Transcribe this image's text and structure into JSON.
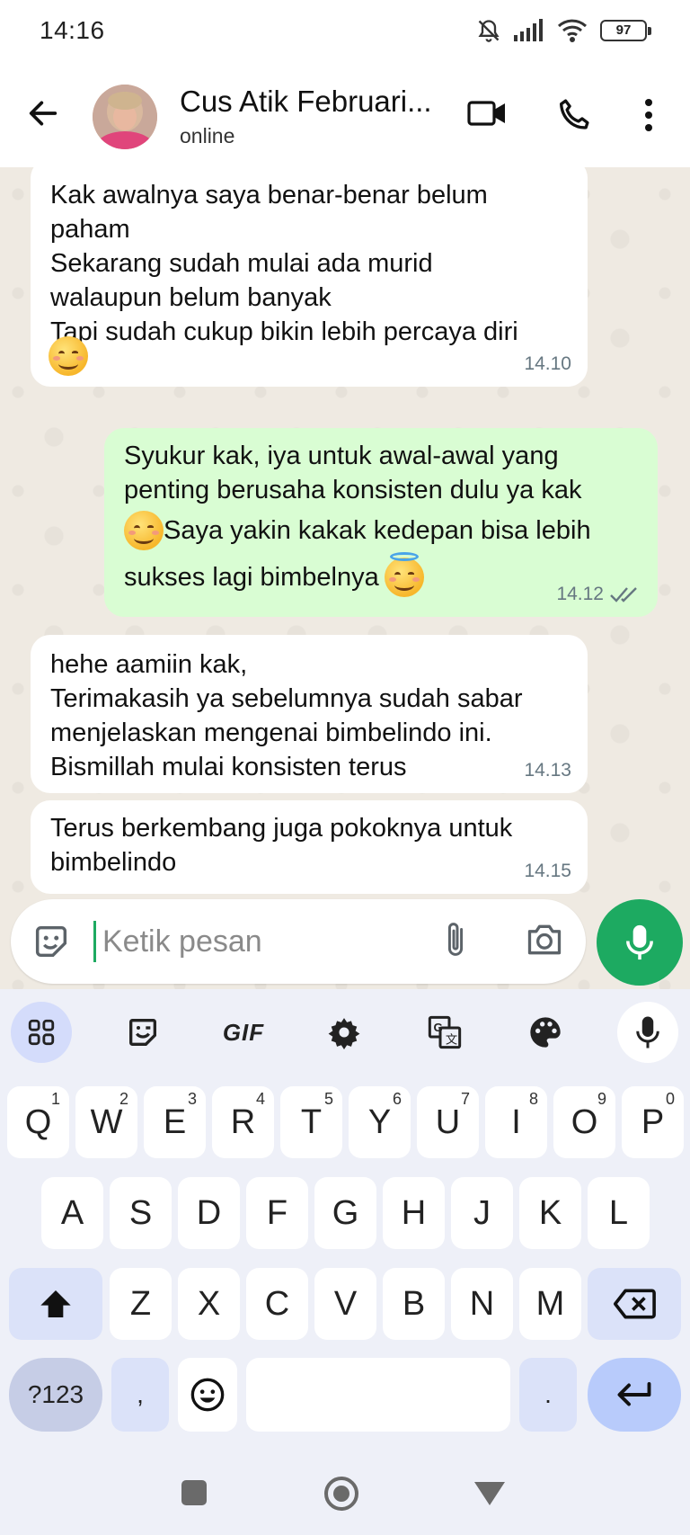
{
  "status_bar": {
    "time": "14:16",
    "battery": "97"
  },
  "header": {
    "contact_name": "Cus Atik Februari...",
    "contact_status": "online"
  },
  "messages": [
    {
      "dir": "in",
      "text": "Kak awalnya saya benar-benar belum\npaham\nSekarang sudah mulai ada murid\nwalaupun belum banyak\nTapi sudah cukup bikin lebih percaya diri",
      "time": "14.10",
      "emoji": "smiling-face-icon"
    },
    {
      "dir": "out",
      "text1": "Syukur kak, iya untuk awal-awal yang\npenting berusaha konsisten dulu ya kak",
      "text2": " Saya yakin kakak kedepan bisa lebih",
      "text3": "sukses lagi bimbelnya",
      "time": "14.12",
      "status": "read"
    },
    {
      "dir": "in",
      "text": "hehe aamiin kak,\nTerimakasih ya sebelumnya sudah sabar\nmenjelaskan mengenai bimbelindo ini.\nBismillah mulai konsisten terus",
      "time": "14.13"
    },
    {
      "dir": "in",
      "text": "Terus berkembang juga pokoknya untuk\nbimbelindo",
      "time": "14.15"
    }
  ],
  "composer": {
    "placeholder": "Ketik pesan"
  },
  "keyboard": {
    "toolbar": [
      "apps-icon",
      "sticker-icon",
      "GIF",
      "gear-icon",
      "translate-icon",
      "palette-icon",
      "microphone-icon"
    ],
    "gif_label": "GIF",
    "row1": [
      {
        "k": "Q",
        "n": "1"
      },
      {
        "k": "W",
        "n": "2"
      },
      {
        "k": "E",
        "n": "3"
      },
      {
        "k": "R",
        "n": "4"
      },
      {
        "k": "T",
        "n": "5"
      },
      {
        "k": "Y",
        "n": "6"
      },
      {
        "k": "U",
        "n": "7"
      },
      {
        "k": "I",
        "n": "8"
      },
      {
        "k": "O",
        "n": "9"
      },
      {
        "k": "P",
        "n": "0"
      }
    ],
    "row2": [
      "A",
      "S",
      "D",
      "F",
      "G",
      "H",
      "J",
      "K",
      "L"
    ],
    "row3": [
      "Z",
      "X",
      "C",
      "V",
      "B",
      "N",
      "M"
    ],
    "sym": "?123",
    "comma": ",",
    "period": "."
  },
  "colors": {
    "accent": "#1daa61",
    "out_bubble": "#d9fdd3",
    "chat_bg": "#efeae2",
    "read_tick": "#667781"
  }
}
